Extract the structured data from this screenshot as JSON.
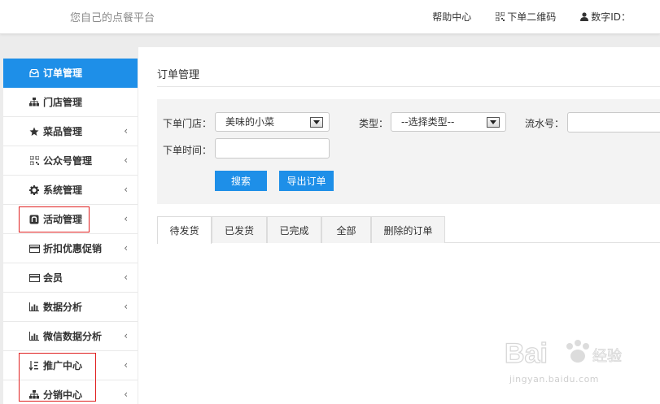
{
  "header": {
    "brand": "您自己的点餐平台",
    "links": [
      {
        "label": "帮助中心",
        "icon": "none"
      },
      {
        "label": "下单二维码",
        "icon": "qrcode-icon"
      },
      {
        "label": "数字ID：",
        "icon": "user-icon"
      }
    ]
  },
  "sidebar": {
    "items": [
      {
        "label": "订单管理",
        "icon": "inbox-icon",
        "active": true
      },
      {
        "label": "门店管理",
        "icon": "sitemap-icon"
      },
      {
        "label": "菜品管理",
        "icon": "star-icon"
      },
      {
        "label": "公众号管理",
        "icon": "qrcode-icon"
      },
      {
        "label": "系统管理",
        "icon": "gear-icon"
      },
      {
        "label": "活动管理",
        "icon": "github-icon"
      },
      {
        "label": "折扣优惠促销",
        "icon": "card-icon"
      },
      {
        "label": "会员",
        "icon": "card-icon"
      },
      {
        "label": "数据分析",
        "icon": "bar-chart-icon"
      },
      {
        "label": "微信数据分析",
        "icon": "bar-chart-icon"
      },
      {
        "label": "推广中心",
        "icon": "sort-icon"
      },
      {
        "label": "分销中心",
        "icon": "sitemap-icon"
      }
    ],
    "chevron": "‹"
  },
  "main": {
    "title": "订单管理",
    "filter": {
      "store_label": "下单门店：",
      "store_value": "美味的小菜",
      "type_label": "类型：",
      "type_value": "--选择类型--",
      "serial_label": "流水号：",
      "time_label": "下单时间：",
      "search_button": "搜索",
      "export_button": "导出订单"
    },
    "tabs": [
      "待发货",
      "已发货",
      "已完成",
      "全部",
      "删除的订单"
    ]
  },
  "watermark": {
    "logo": "Baidu经验",
    "url": "jingyan.baidu.com"
  },
  "colors": {
    "accent": "#1e8fe8",
    "highlight": "#e02020"
  }
}
